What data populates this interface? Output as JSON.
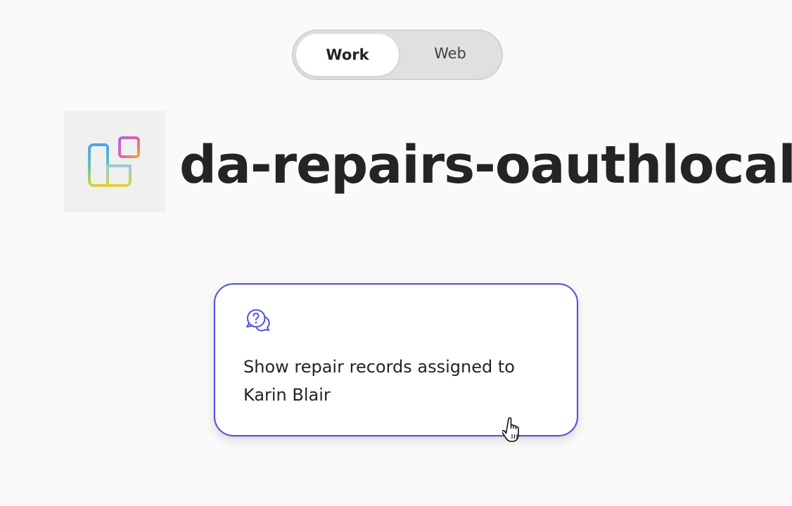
{
  "toggle": {
    "options": [
      {
        "label": "Work",
        "selected": true
      },
      {
        "label": "Web",
        "selected": false
      }
    ]
  },
  "header": {
    "app_icon": "app-grid-icon",
    "title": "da-repairs-oauthlocal"
  },
  "prompt_card": {
    "icon": "chat-question-icon",
    "text": "Show repair records assigned to Karin Blair"
  },
  "colors": {
    "accent": "#4f52d8",
    "background": "#fafafa",
    "card": "#ffffff",
    "toggle_track": "#e0e0e0",
    "text": "#242424"
  }
}
